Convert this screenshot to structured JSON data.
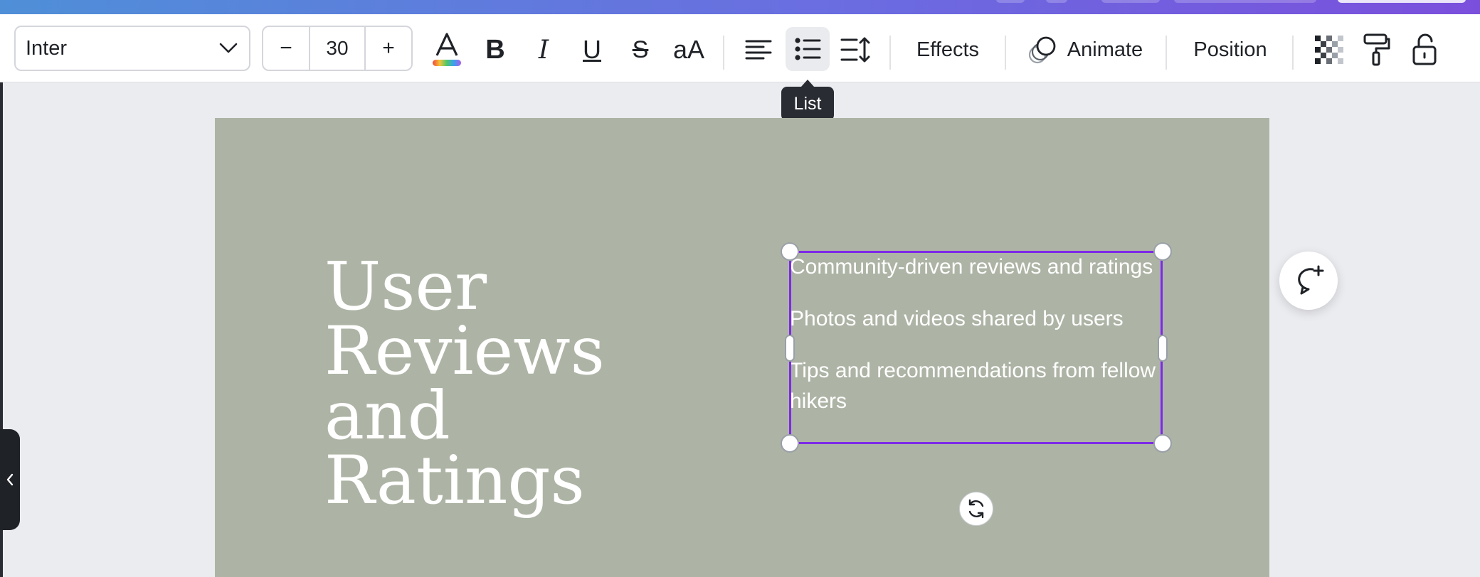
{
  "toolbar": {
    "font_name": "Inter",
    "font_size": "30",
    "decrease_label": "−",
    "increase_label": "+",
    "bold_label": "B",
    "italic_label": "I",
    "underline_label": "U",
    "strike_label": "S",
    "case_label": "aA",
    "effects_label": "Effects",
    "animate_label": "Animate",
    "position_label": "Position",
    "active_tool": "list"
  },
  "tooltip": {
    "text": "List"
  },
  "canvas": {
    "background": "#adb4a5",
    "heading_lines": [
      "User",
      "Reviews",
      "and",
      "Ratings"
    ],
    "list_items": [
      "Community-driven reviews and ratings",
      "Photos and videos shared by users",
      "Tips and recommendations from fellow hikers"
    ]
  },
  "colors": {
    "selection": "#7d2ae8",
    "text_color_bar": "rainbow"
  },
  "icons": {
    "text_color": "text-color-icon",
    "align": "align-left-icon",
    "list": "bulleted-list-icon",
    "spacing": "line-spacing-icon",
    "transparency": "transparency-icon",
    "copy_style": "paint-roller-icon",
    "lock": "lock-icon",
    "rotate": "rotate-icon",
    "comment": "add-comment-icon",
    "collapse": "chevron-left-icon"
  }
}
